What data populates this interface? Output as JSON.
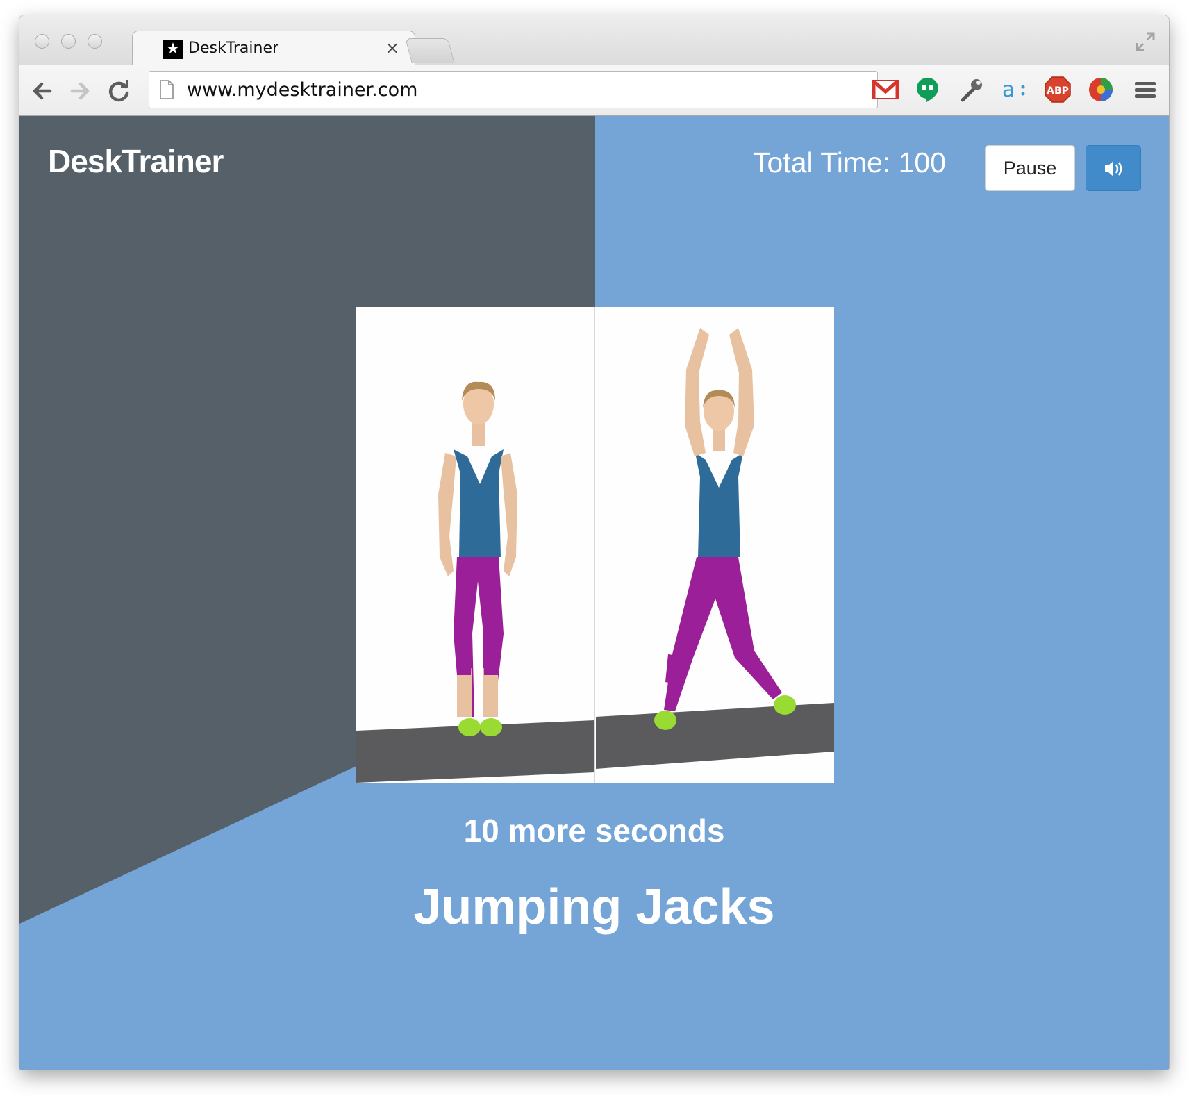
{
  "browser": {
    "tab": {
      "title": "DeskTrainer",
      "close": "×"
    },
    "address_bar": {
      "url": "www.mydesktrainer.com"
    },
    "extensions": [
      "gmail-icon",
      "hangouts-icon",
      "wrench-icon",
      "amazon-assistant-icon",
      "adblock-plus-icon",
      "color-wheel-icon"
    ]
  },
  "header": {
    "brand": "DeskTrainer",
    "total_time": "Total Time: 100",
    "pause_label": "Pause",
    "sound_icon": "volume-icon"
  },
  "exercise": {
    "countdown": "10 more seconds",
    "name": "Jumping Jacks",
    "images": [
      "standing-pose",
      "arms-raised-pose"
    ]
  },
  "colors": {
    "page_blue": "#75a5d7",
    "panel_slate": "#566069",
    "button_blue": "#428bca"
  }
}
